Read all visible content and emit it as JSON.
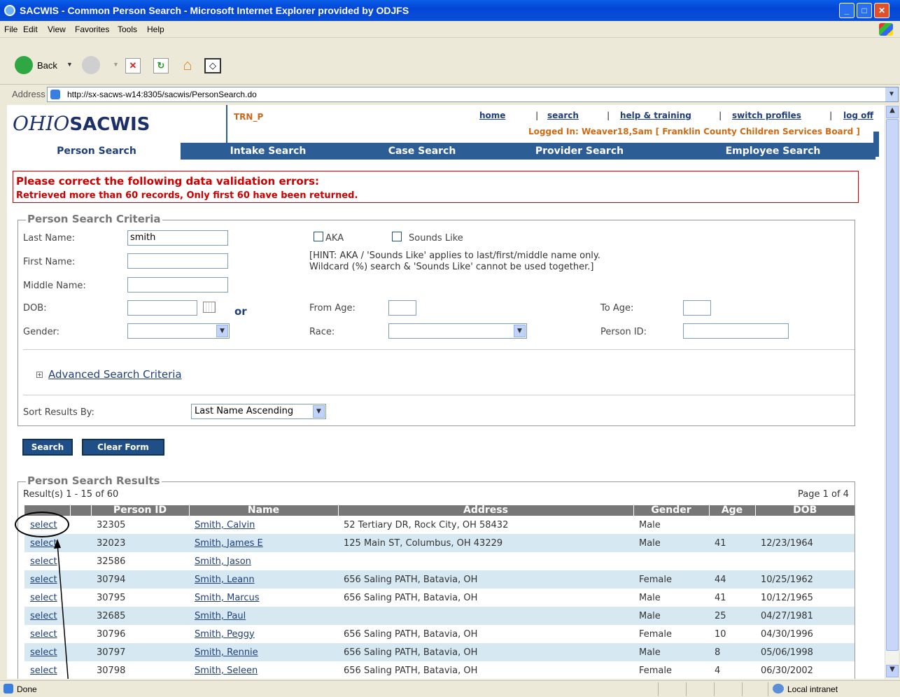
{
  "window": {
    "title": "SACWIS - Common Person Search - Microsoft Internet Explorer provided by ODJFS",
    "controls": [
      "minimize",
      "maximize",
      "close"
    ]
  },
  "menu": [
    "File",
    "Edit",
    "View",
    "Favorites",
    "Tools",
    "Help"
  ],
  "toolbar": {
    "back_label": "Back"
  },
  "address": {
    "label": "Address",
    "url": "http://sx-sacws-w14:8305/sacwis/PersonSearch.do"
  },
  "header": {
    "logo_ohio": "OHIO",
    "logo_sacwis": "SACWIS",
    "env": "TRN_P",
    "links": [
      "home",
      "search",
      "help & training",
      "switch profiles",
      "log off"
    ],
    "logged_in": "Logged In:  Weaver18,Sam [ Franklin County Children Services Board ]"
  },
  "tabs": [
    "Person Search",
    "Intake Search",
    "Case Search",
    "Provider Search",
    "Employee Search"
  ],
  "active_tab": "Person Search",
  "error": {
    "title": "Please correct the following data validation errors:",
    "message": "Retrieved more than 60 records, Only first 60 have been returned."
  },
  "criteria": {
    "legend": "Person Search Criteria",
    "last_name_label": "Last Name:",
    "last_name_value": "smith",
    "first_name_label": "First Name:",
    "middle_name_label": "Middle Name:",
    "dob_label": "DOB:",
    "or_label": "or",
    "gender_label": "Gender:",
    "aka_label": "AKA",
    "sounds_like_label": "Sounds Like",
    "hint_line1": "[HINT: AKA / 'Sounds Like' applies to last/first/middle name only.",
    "hint_line2": "Wildcard (%) search & 'Sounds Like' cannot be used together.]",
    "from_age_label": "From Age:",
    "to_age_label": "To Age:",
    "race_label": "Race:",
    "person_id_label": "Person ID:",
    "advanced_label": "Advanced Search Criteria",
    "sort_label": "Sort Results By:",
    "sort_value": "Last Name Ascending"
  },
  "buttons": {
    "search": "Search",
    "clear": "Clear Form"
  },
  "results": {
    "legend": "Person Search Results",
    "count": "Result(s) 1 - 15 of 60",
    "page": "Page 1 of 4",
    "columns": [
      "",
      "",
      "Person ID",
      "Name",
      "Address",
      "Gender",
      "Age",
      "DOB"
    ],
    "rows": [
      [
        "select",
        "32305",
        "Smith, Calvin",
        "52 Tertiary DR, Rock City, OH 58432",
        "Male",
        "",
        ""
      ],
      [
        "select",
        "32023",
        "Smith, James E",
        "125 Main ST, Columbus, OH 43229",
        "Male",
        "41",
        "12/23/1964"
      ],
      [
        "select",
        "32586",
        "Smith, Jason",
        "",
        "",
        "",
        ""
      ],
      [
        "select",
        "30794",
        "Smith, Leann",
        "656 Saling PATH, Batavia, OH",
        "Female",
        "44",
        "10/25/1962"
      ],
      [
        "select",
        "30795",
        "Smith, Marcus",
        "656 Saling PATH, Batavia, OH",
        "Male",
        "41",
        "10/12/1965"
      ],
      [
        "select",
        "32685",
        "Smith, Paul",
        "",
        "Male",
        "25",
        "04/27/1981"
      ],
      [
        "select",
        "30796",
        "Smith, Peggy",
        "656 Saling PATH, Batavia, OH",
        "Female",
        "10",
        "04/30/1996"
      ],
      [
        "select",
        "30797",
        "Smith, Rennie",
        "656 Saling PATH, Batavia, OH",
        "Male",
        "8",
        "05/06/1998"
      ],
      [
        "select",
        "30798",
        "Smith, Seleen",
        "656 Saling PATH, Batavia, OH",
        "Female",
        "4",
        "06/30/2002"
      ]
    ]
  },
  "status": {
    "text": "Done",
    "zone": "Local intranet"
  }
}
